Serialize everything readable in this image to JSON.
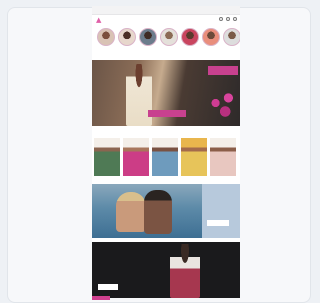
{
  "browser": {
    "url": ""
  },
  "colors": {
    "brand_pink": "#d0408f",
    "background": "#eef1f5",
    "dark_section": "#1a1a1c",
    "pool_panel": "#b7c9dc"
  },
  "header": {
    "logo_icon": "brand-logo-icon",
    "nav_icons": [
      "search-icon",
      "user-icon",
      "bag-icon"
    ]
  },
  "categories": [
    {
      "label": ""
    },
    {
      "label": ""
    },
    {
      "label": ""
    },
    {
      "label": ""
    },
    {
      "label": ""
    },
    {
      "label": ""
    },
    {
      "label": ""
    }
  ],
  "hero": {
    "tag": "",
    "cta": ""
  },
  "products_section": {
    "label": ""
  },
  "pool_banner": {
    "text": "",
    "cta": ""
  },
  "dark_banner": {
    "title": "",
    "text": "",
    "cta": ""
  }
}
